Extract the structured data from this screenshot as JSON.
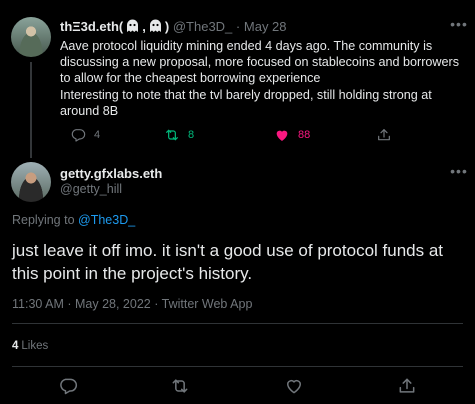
{
  "parent": {
    "author_name": "thΞ3d.eth(",
    "author_name_tail": ")",
    "handle": "@The3D_",
    "separator": "·",
    "date": "May 28",
    "body": [
      "Aave protocol liquidity mining ended 4 days ago. The community is discussing a new proposal, more focused on stablecoins and borrowers to allow for the cheapest borrowing experience",
      "Interesting to note that the tvl barely dropped, still holding strong at around 8B"
    ],
    "actions": {
      "reply_count": "4",
      "retweet_count": "8",
      "like_count": "88"
    },
    "icons": [
      "ghost-emoji-icon",
      "ghost-emoji-icon",
      "more-icon",
      "reply-icon",
      "retweet-icon",
      "like-icon",
      "share-icon"
    ]
  },
  "tweet": {
    "author_name": "getty.gfxlabs.eth",
    "handle": "@getty_hill",
    "replying_prefix": "Replying to",
    "replying_to": "@The3D_",
    "text": "just leave it off imo. it isn't a good use of protocol funds at this point in the project's history.",
    "meta": "11:30 AM · May 28, 2022 · Twitter Web App",
    "likes_count": "4",
    "likes_label": "Likes"
  },
  "colors": {
    "background": "#000000",
    "text": "#e7e9ea",
    "muted": "#71767b",
    "link": "#1d9bf0",
    "retweet": "#00ba7c",
    "like": "#f91880",
    "divider": "#2f3336"
  }
}
